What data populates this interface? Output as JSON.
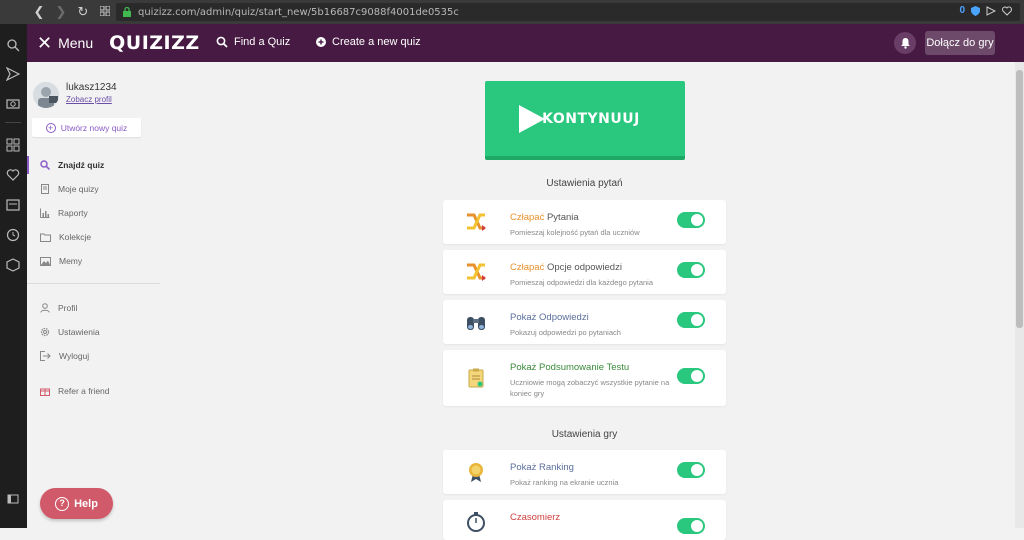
{
  "browser": {
    "url": "quizizz.com/admin/quiz/start_new/5b16687c9088f4001de0535c",
    "badge_count": "0"
  },
  "header": {
    "menu_label": "Menu",
    "logo": "QUIZIZZ",
    "find_quiz": "Find a Quiz",
    "create_quiz": "Create a new quiz",
    "join_game": "Dołącz do gry"
  },
  "sidebar": {
    "username": "lukasz1234",
    "profile_link": "Zobacz profil",
    "create_button": "Utwórz nowy quiz",
    "items": [
      {
        "label": "Znajdź quiz",
        "icon": "search-icon"
      },
      {
        "label": "Moje quizy",
        "icon": "document-icon"
      },
      {
        "label": "Raporty",
        "icon": "chart-icon"
      },
      {
        "label": "Kolekcje",
        "icon": "folder-icon"
      },
      {
        "label": "Memy",
        "icon": "image-icon"
      }
    ],
    "account_items": [
      {
        "label": "Profil",
        "icon": "user-icon"
      },
      {
        "label": "Ustawienia",
        "icon": "gear-icon"
      },
      {
        "label": "Wyloguj",
        "icon": "logout-icon"
      },
      {
        "label": "Refer a friend",
        "icon": "gift-icon"
      }
    ],
    "help_label": "Help"
  },
  "main": {
    "continue_label": "KONTYNUUJ",
    "question_settings_title": "Ustawienia pytań",
    "game_settings_title": "Ustawienia gry",
    "question_settings": [
      {
        "title_accent": "Człapać",
        "title_rest": " Pytania",
        "desc": "Pomieszaj kolejność pytań dla uczniów",
        "enabled": true
      },
      {
        "title_accent": "Człapać",
        "title_rest": " Opcje odpowiedzi",
        "desc": "Pomieszaj odpowiedzi dla każdego pytania",
        "enabled": true
      },
      {
        "title": "Pokaż Odpowiedzi",
        "desc": "Pokazuj odpowiedzi po pytaniach",
        "enabled": true
      },
      {
        "title": "Pokaż Podsumowanie Testu",
        "desc": "Uczniowie mogą zobaczyć wszystkie pytanie na koniec gry",
        "enabled": true
      }
    ],
    "game_settings": [
      {
        "title": "Pokaż Ranking",
        "desc": "Pokaż ranking na ekranie ucznia",
        "enabled": true
      },
      {
        "title": "Czasomierz",
        "enabled": true
      }
    ]
  },
  "colors": {
    "header_bg": "#461a42",
    "accent_green": "#2ac77e",
    "accent_purple": "#8a5cc7",
    "accent_orange": "#e8912c",
    "title_green": "#3a8a3a",
    "title_red": "#d04040",
    "help_red": "#d15a6a"
  }
}
